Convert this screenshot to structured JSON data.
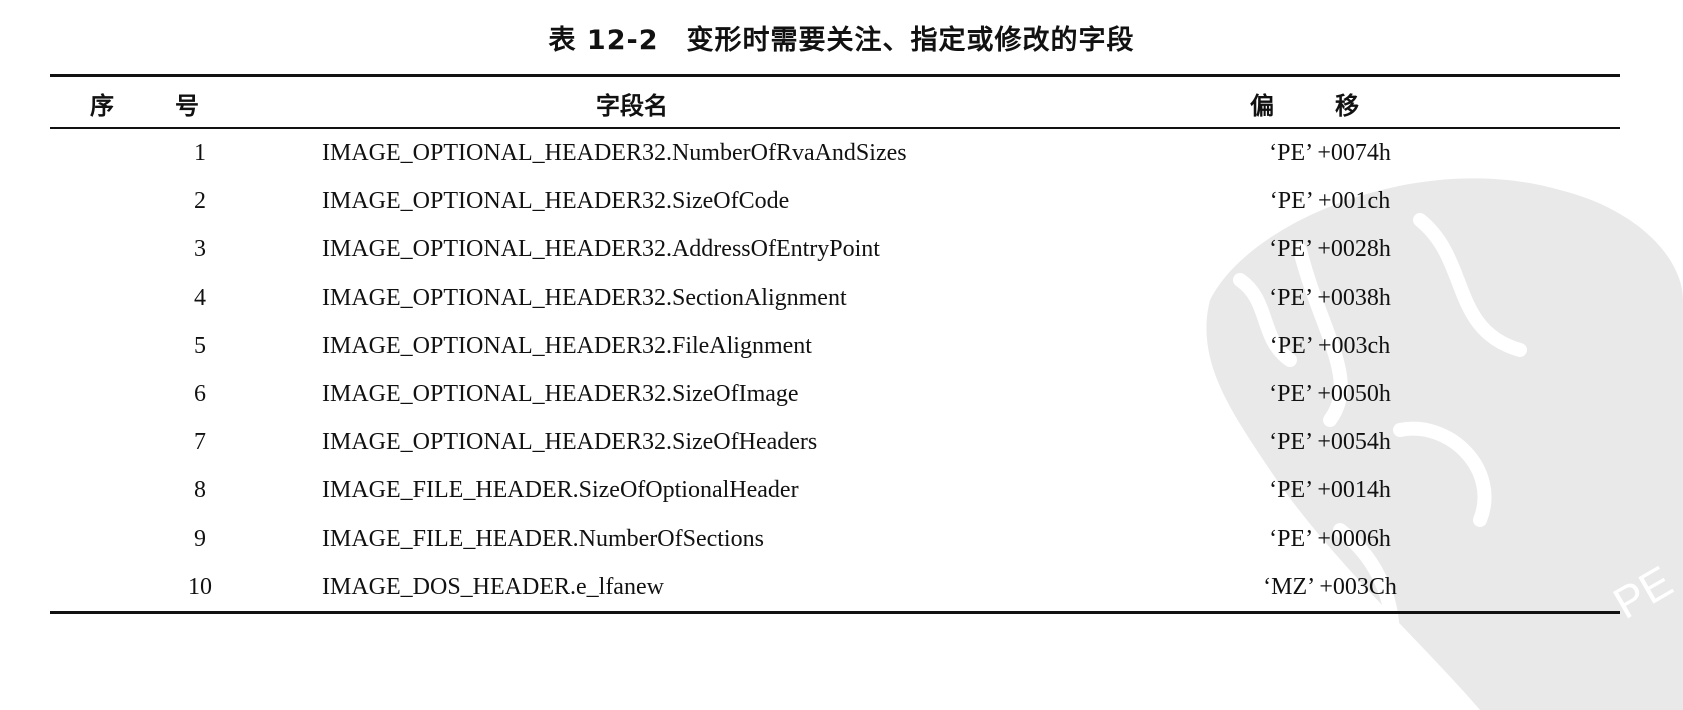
{
  "title": "表 12-2　变形时需要关注、指定或修改的字段",
  "headers": {
    "no_a": "序",
    "no_b": "号",
    "name": "字段名",
    "offset_a": "偏",
    "offset_b": "移"
  },
  "rows": [
    {
      "no": "1",
      "name": "IMAGE_OPTIONAL_HEADER32.NumberOfRvaAndSizes",
      "offset": "‘PE’ +0074h"
    },
    {
      "no": "2",
      "name": "IMAGE_OPTIONAL_HEADER32.SizeOfCode",
      "offset": "‘PE’ +001ch"
    },
    {
      "no": "3",
      "name": "IMAGE_OPTIONAL_HEADER32.AddressOfEntryPoint",
      "offset": "‘PE’ +0028h"
    },
    {
      "no": "4",
      "name": "IMAGE_OPTIONAL_HEADER32.SectionAlignment",
      "offset": "‘PE’ +0038h"
    },
    {
      "no": "5",
      "name": "IMAGE_OPTIONAL_HEADER32.FileAlignment",
      "offset": "‘PE’ +003ch"
    },
    {
      "no": "6",
      "name": "IMAGE_OPTIONAL_HEADER32.SizeOfImage",
      "offset": "‘PE’ +0050h"
    },
    {
      "no": "7",
      "name": "IMAGE_OPTIONAL_HEADER32.SizeOfHeaders",
      "offset": "‘PE’ +0054h"
    },
    {
      "no": "8",
      "name": "IMAGE_FILE_HEADER.SizeOfOptionalHeader",
      "offset": "‘PE’ +0014h"
    },
    {
      "no": "9",
      "name": "IMAGE_FILE_HEADER.NumberOfSections",
      "offset": "‘PE’ +0006h"
    },
    {
      "no": "10",
      "name": "IMAGE_DOS_HEADER.e_lfanew",
      "offset": "‘MZ’ +003Ch"
    }
  ],
  "watermark_text": "PE"
}
